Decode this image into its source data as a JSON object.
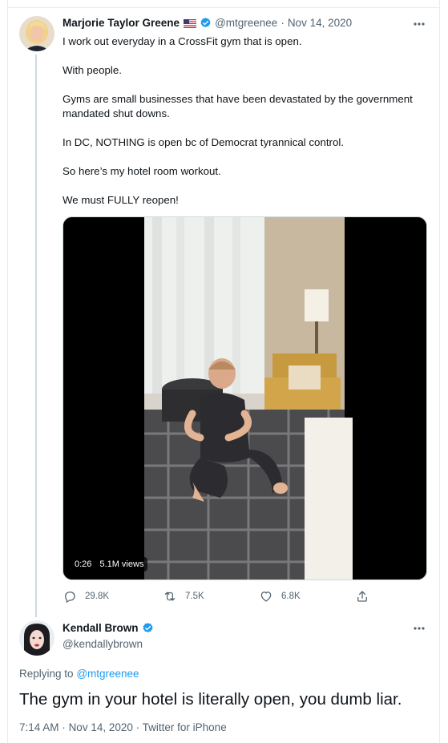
{
  "tweet": {
    "author_name": "Marjorie Taylor Greene",
    "flag_icon": "us-flag-icon",
    "verified_icon": "verified-badge-icon",
    "handle": "@mtgreenee",
    "separator": "·",
    "date": "Nov 14, 2020",
    "paragraphs": [
      "I work out everyday in a CrossFit gym that is open.",
      "With people.",
      "Gyms are small businesses that have been devastated by the government mandated shut downs.",
      "In DC, NOTHING is open bc of Democrat tyrannical control.",
      "So here’s my hotel room workout.",
      "We must FULLY reopen!"
    ],
    "video": {
      "duration": "0:26",
      "views": "5.1M views"
    },
    "actions": {
      "reply_count": "29.8K",
      "retweet_count": "7.5K",
      "like_count": "6.8K"
    }
  },
  "reply": {
    "author_name": "Kendall Brown",
    "verified_icon": "verified-badge-icon",
    "handle": "@kendallybrown",
    "replying_prefix": "Replying to",
    "replying_to": "@mtgreenee",
    "text": "The gym in your hotel is literally open, you dumb liar.",
    "time": "7:14 AM",
    "separator": "·",
    "date": "Nov 14, 2020",
    "separator2": "·",
    "client": "Twitter for iPhone"
  },
  "colors": {
    "accent": "#1d9bf0",
    "text": "#0f1419",
    "muted": "#536471",
    "border": "#cfd9de"
  }
}
